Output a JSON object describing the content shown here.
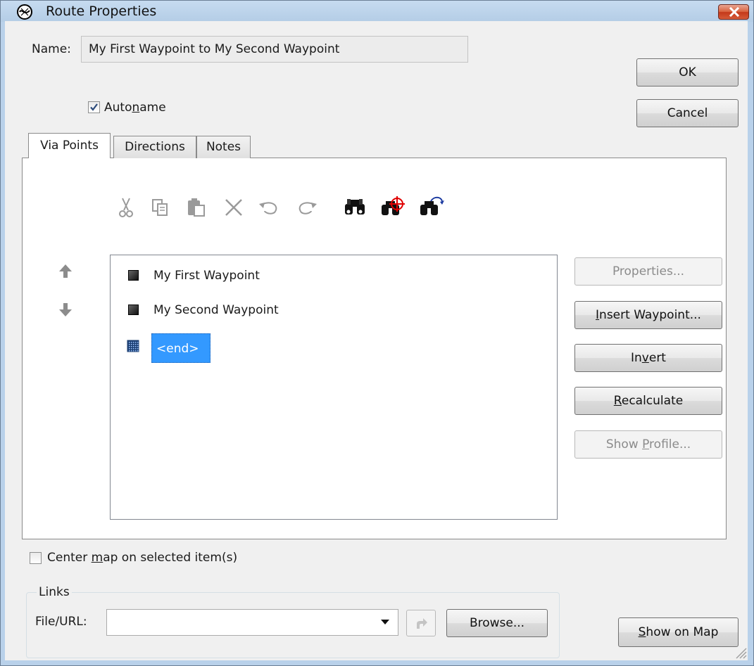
{
  "window": {
    "title": "Route Properties",
    "close_icon": "close-icon",
    "app_icon": "route-icon"
  },
  "form": {
    "name_label": "Name:",
    "name_value": "My First Waypoint to My Second Waypoint",
    "autoname_prefix": "Auto",
    "autoname_mnemonic": "n",
    "autoname_suffix": "ame",
    "autoname_checked": true
  },
  "buttons": {
    "ok": "OK",
    "cancel": "Cancel",
    "properties": "Properties...",
    "insert_mnemonic": "I",
    "insert_rest": "nsert Waypoint...",
    "invert_pre": "In",
    "invert_mnemonic": "v",
    "invert_post": "ert",
    "recalc_mnemonic": "R",
    "recalc_rest": "ecalculate",
    "profile_pre": "Show ",
    "profile_mnemonic": "P",
    "profile_post": "rofile...",
    "browse": "Browse...",
    "showmap_mnemonic": "S",
    "showmap_rest": "how on Map"
  },
  "tabs": [
    {
      "label": "Via Points",
      "active": true
    },
    {
      "label": "Directions",
      "active": false
    },
    {
      "label": "Notes",
      "active": false
    }
  ],
  "toolbar": [
    "cut-icon",
    "copy-icon",
    "paste-icon",
    "delete-icon",
    "undo-icon",
    "redo-icon",
    "find-icon",
    "find-nearest-icon",
    "find-next-icon"
  ],
  "via_points": {
    "items": [
      "My First Waypoint",
      "My Second Waypoint"
    ],
    "end_item": "<end>"
  },
  "center_map": {
    "pre": "Center ",
    "mnemonic": "m",
    "post": "ap on selected item(s)",
    "checked": false
  },
  "links": {
    "group_label": "Links",
    "file_label": "File/URL:",
    "value": ""
  },
  "colors": {
    "selection": "#3399ff",
    "window_frame": "#b9d1ea",
    "dialog_bg": "#f0f0f0"
  }
}
